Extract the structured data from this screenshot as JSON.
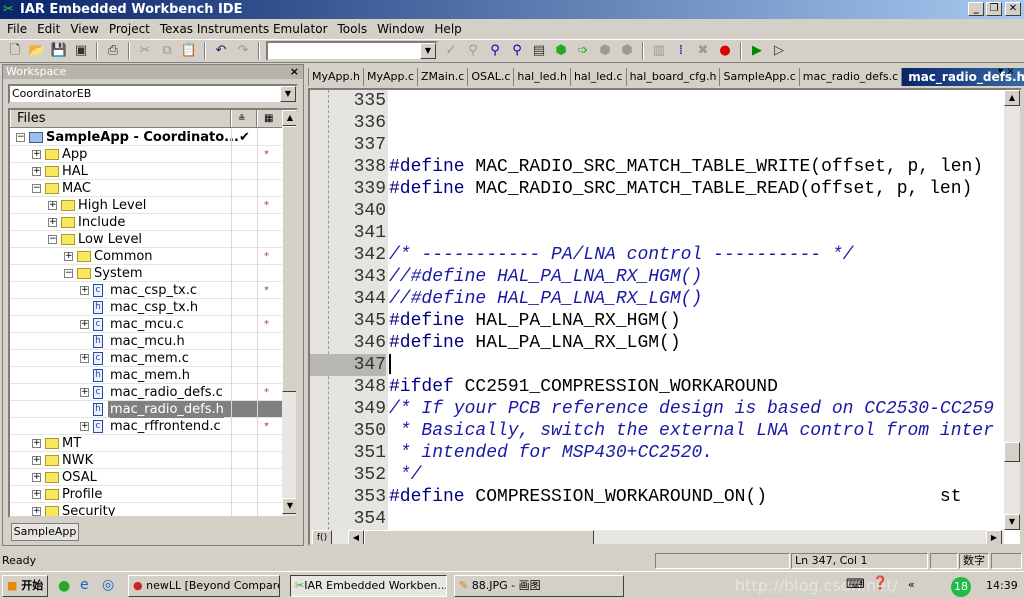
{
  "window": {
    "title": "IAR Embedded Workbench IDE"
  },
  "menu": [
    "File",
    "Edit",
    "View",
    "Project",
    "Texas Instruments Emulator",
    "Tools",
    "Window",
    "Help"
  ],
  "workspace": {
    "title": "Workspace",
    "config": "CoordinatorEB",
    "files_header": "Files",
    "tab": "SampleApp",
    "tree": [
      {
        "label": "SampleApp - Coordinato...",
        "level": 0,
        "type": "project",
        "expanded": true,
        "check": "✔",
        "bold": true
      },
      {
        "label": "App",
        "level": 1,
        "type": "folder",
        "expanded": false,
        "star": true
      },
      {
        "label": "HAL",
        "level": 1,
        "type": "folder",
        "expanded": false
      },
      {
        "label": "MAC",
        "level": 1,
        "type": "folder",
        "expanded": true
      },
      {
        "label": "High Level",
        "level": 2,
        "type": "folder",
        "expanded": false,
        "star": true
      },
      {
        "label": "Include",
        "level": 2,
        "type": "folder",
        "expanded": false
      },
      {
        "label": "Low Level",
        "level": 2,
        "type": "folder",
        "expanded": true
      },
      {
        "label": "Common",
        "level": 3,
        "type": "folder",
        "expanded": false,
        "star": true
      },
      {
        "label": "System",
        "level": 3,
        "type": "folder",
        "expanded": true
      },
      {
        "label": "mac_csp_tx.c",
        "level": 4,
        "type": "c",
        "expanded": false,
        "star": true
      },
      {
        "label": "mac_csp_tx.h",
        "level": 4,
        "type": "h"
      },
      {
        "label": "mac_mcu.c",
        "level": 4,
        "type": "c",
        "expanded": false,
        "star": true
      },
      {
        "label": "mac_mcu.h",
        "level": 4,
        "type": "h"
      },
      {
        "label": "mac_mem.c",
        "level": 4,
        "type": "c",
        "expanded": false
      },
      {
        "label": "mac_mem.h",
        "level": 4,
        "type": "h"
      },
      {
        "label": "mac_radio_defs.c",
        "level": 4,
        "type": "c",
        "expanded": false,
        "star": true
      },
      {
        "label": "mac_radio_defs.h",
        "level": 4,
        "type": "h",
        "selected": true
      },
      {
        "label": "mac_rffrontend.c",
        "level": 4,
        "type": "c",
        "expanded": false,
        "star": true
      },
      {
        "label": "MT",
        "level": 1,
        "type": "folder",
        "expanded": false
      },
      {
        "label": "NWK",
        "level": 1,
        "type": "folder",
        "expanded": false
      },
      {
        "label": "OSAL",
        "level": 1,
        "type": "folder",
        "expanded": false
      },
      {
        "label": "Profile",
        "level": 1,
        "type": "folder",
        "expanded": false
      },
      {
        "label": "Security",
        "level": 1,
        "type": "folder",
        "expanded": false
      }
    ]
  },
  "editor": {
    "tabs": [
      "MyApp.h",
      "MyApp.c",
      "ZMain.c",
      "OSAL.c",
      "hal_led.h",
      "hal_led.c",
      "hal_board_cfg.h",
      "SampleApp.c",
      "mac_radio_defs.c",
      "mac_radio_defs.h"
    ],
    "active_tab": "mac_radio_defs.h",
    "current_line": "347",
    "lines": [
      {
        "n": "335",
        "kw": "",
        "code": "",
        "cm": ""
      },
      {
        "n": "336",
        "kw": "",
        "code": "",
        "cm": ""
      },
      {
        "n": "337",
        "kw": "",
        "code": "",
        "cm": ""
      },
      {
        "n": "338",
        "kw": "#define",
        "code": " MAC_RADIO_SRC_MATCH_TABLE_WRITE(offset, p, len)",
        "cm": ""
      },
      {
        "n": "339",
        "kw": "#define",
        "code": " MAC_RADIO_SRC_MATCH_TABLE_READ(offset, p, len)",
        "cm": ""
      },
      {
        "n": "340",
        "kw": "",
        "code": "",
        "cm": ""
      },
      {
        "n": "341",
        "kw": "",
        "code": "",
        "cm": ""
      },
      {
        "n": "342",
        "kw": "",
        "code": "",
        "cm": "/* ----------- PA/LNA control ---------- */"
      },
      {
        "n": "343",
        "kw": "",
        "code": "",
        "cm": "//#define HAL_PA_LNA_RX_HGM()"
      },
      {
        "n": "344",
        "kw": "",
        "code": "",
        "cm": "//#define HAL_PA_LNA_RX_LGM()"
      },
      {
        "n": "345",
        "kw": "#define",
        "code": " HAL_PA_LNA_RX_HGM()",
        "cm": ""
      },
      {
        "n": "346",
        "kw": "#define",
        "code": " HAL_PA_LNA_RX_LGM()",
        "cm": ""
      },
      {
        "n": "347",
        "kw": "",
        "code": "",
        "cm": ""
      },
      {
        "n": "348",
        "kw": "#ifdef",
        "code": " CC2591_COMPRESSION_WORKAROUND",
        "cm": ""
      },
      {
        "n": "349",
        "kw": "",
        "code": "",
        "cm": "/* If your PCB reference design is based on CC2530-CC259"
      },
      {
        "n": "350",
        "kw": "",
        "code": "",
        "cm": " * Basically, switch the external LNA control from inter"
      },
      {
        "n": "351",
        "kw": "",
        "code": "",
        "cm": " * intended for MSP430+CC2520."
      },
      {
        "n": "352",
        "kw": "",
        "code": "",
        "cm": " */"
      },
      {
        "n": "353",
        "kw": "#define",
        "code": " COMPRESSION_WORKAROUND_ON()                st",
        "cm": ""
      },
      {
        "n": "354",
        "kw": "",
        "code": "",
        "cm": ""
      }
    ],
    "fn_button": "f()"
  },
  "status": {
    "text": "Ready",
    "position": "Ln 347, Col 1",
    "mode": "数字"
  },
  "taskbar": {
    "start": "开始",
    "tasks": [
      "newLL  [Beyond Compare]",
      "IAR Embedded Workben...",
      "88.JPG - 画图"
    ],
    "active_task": 1,
    "clock": "14:39",
    "badge": "18",
    "watermark": "http://blog.csdn.net/"
  }
}
